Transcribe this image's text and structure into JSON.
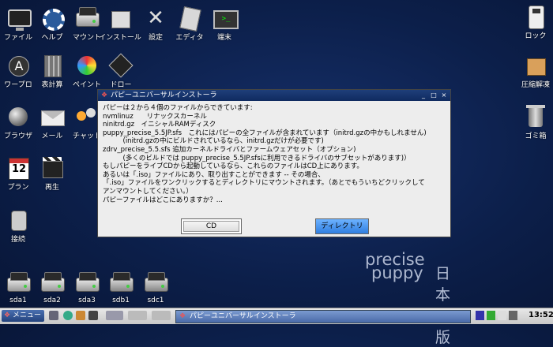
{
  "desktop": {
    "icons_top": [
      "ファイル",
      "ヘルプ",
      "マウント",
      "インストール",
      "設定",
      "エディタ",
      "端末"
    ],
    "icons_left": [
      "ワープロ",
      "表計算",
      "ペイント",
      "ドロー",
      "ブラウザ",
      "メール",
      "チャット",
      "プラン",
      "再生",
      "接続"
    ],
    "icons_right": [
      "ロック",
      "圧縮解凍",
      "ゴミ箱"
    ],
    "drives": [
      "sda1",
      "sda2",
      "sda3",
      "sdb1",
      "sdc1"
    ],
    "watermark": {
      "line1": "precise",
      "line2": "puppy",
      "line3": "日本語版"
    }
  },
  "dialog": {
    "title": "パピーユニバーサルインストーラ",
    "controls": {
      "minimize": "_",
      "maximize": "□",
      "close": "×"
    },
    "lines": [
      "パピーは２から４個のファイルからできています:",
      "nvmlinuz　　リナックスカーネル",
      "ninitrd.gz　イニシャルRAMディスク",
      "puppy_precise_5.5JP.sfs　これにはパピーの全ファイルが含まれています（initrd.gzの中かもしれません)",
      "　　　(initrd.gzの中にビルドされているなら、initrd.gzだけが必要です)",
      "zdrv_precise_5.5.sfs 追加カーネルドライバとファームウェアセット（オプション)",
      "　　　(多くのビルドでは puppy_precise_5.5JP.sfsに利用できるドライバのサブセットがあります)）",
      "もしパピーをライブCDから起動しているなら、これらのファイルはCD上にあります。",
      "あるいは「.iso」ファイルにあり、取り出すことができます -- その場合、",
      "「.iso」ファイルをワンクリックするとディレクトリにマウントされます。（あとでもういちどクリックして",
      "アンマウントしてください。）",
      "パピーファイルはどこにありますか？..."
    ],
    "buttons": {
      "cd": "CD",
      "directory": "ディレクトリ"
    }
  },
  "taskbar": {
    "menu_label": "メニュー",
    "active_window": "パピーユニバーサルインストーラ",
    "clock": "13:52"
  }
}
